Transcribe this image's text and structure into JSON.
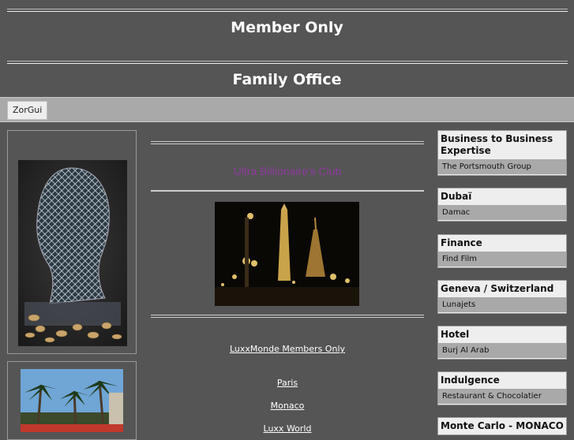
{
  "header": {
    "title_top": "Member Only",
    "title_sub": "Family Office"
  },
  "nav": {
    "tab_label": "ZorGui"
  },
  "center": {
    "club_title": "Ultra Billionaire's Club",
    "members_link": "LuxxMonde Members Only",
    "links": [
      "Paris",
      "Monaco",
      "Luxx World"
    ]
  },
  "sidebar_right": {
    "sections": [
      {
        "title": "Business to Business Expertise",
        "item": "The Portsmouth Group"
      },
      {
        "title": "Dubaï",
        "item": "Damac"
      },
      {
        "title": "Finance",
        "item": "Find Film"
      },
      {
        "title": "Geneva / Switzerland",
        "item": "Lunajets"
      },
      {
        "title": "Hotel",
        "item": "Burj Al Arab"
      },
      {
        "title": "Indulgence",
        "item": "Restaurant & Chocolatier"
      },
      {
        "title": "Monte Carlo - MONACO",
        "item": ""
      }
    ]
  },
  "colors": {
    "background": "#555555",
    "club_title": "#8e3a9e",
    "tabbar": "#a9a9a9"
  }
}
